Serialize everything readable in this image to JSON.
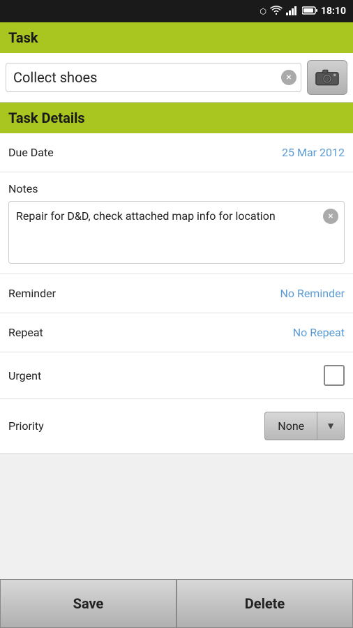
{
  "statusBar": {
    "time": "18:10"
  },
  "taskSection": {
    "header": "Task",
    "inputValue": "Collect shoes",
    "clearBtn": "×"
  },
  "taskDetails": {
    "header": "Task Details",
    "dueDate": {
      "label": "Due Date",
      "value": "25 Mar 2012"
    },
    "notes": {
      "label": "Notes",
      "value": "Repair for D&D, check attached map info for location",
      "clearBtn": "×"
    },
    "reminder": {
      "label": "Reminder",
      "value": "No Reminder"
    },
    "repeat": {
      "label": "Repeat",
      "value": "No Repeat"
    },
    "urgent": {
      "label": "Urgent"
    },
    "priority": {
      "label": "Priority",
      "value": "None",
      "arrowIcon": "▼"
    }
  },
  "buttons": {
    "save": "Save",
    "delete": "Delete"
  }
}
